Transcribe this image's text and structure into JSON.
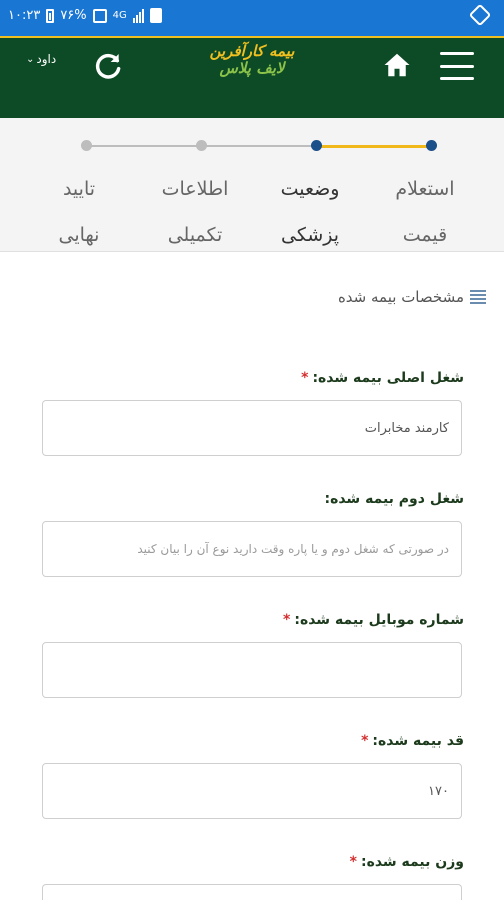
{
  "status_bar": {
    "time": "۱۰:۲۳",
    "battery": "۷۶%",
    "network": "4G"
  },
  "header": {
    "user_name": "داود",
    "logo_line1": "بیمه کارآفرین",
    "logo_line2": "لایف پلاس"
  },
  "stepper": {
    "steps": [
      {
        "line1": "استعلام",
        "line2": "قیمت"
      },
      {
        "line1": "وضعیت",
        "line2": "پزشکی"
      },
      {
        "line1": "اطلاعات",
        "line2": "تکمیلی"
      },
      {
        "line1": "تایید",
        "line2": "نهایی"
      }
    ]
  },
  "form": {
    "section_title": "مشخصات بیمه شده",
    "required_marker": "*",
    "fields": [
      {
        "label": "شغل اصلی بیمه شده:",
        "required": true,
        "value": "کارمند مخابرات",
        "placeholder": ""
      },
      {
        "label": "شغل دوم بیمه شده:",
        "required": false,
        "value": "",
        "placeholder": "در صورتی که شغل دوم و یا پاره وقت دارید نوع آن را بیان کنید"
      },
      {
        "label": "شماره موبایل بیمه شده:",
        "required": true,
        "value": "",
        "placeholder": ""
      },
      {
        "label": "قد بیمه شده:",
        "required": true,
        "value": "۱۷۰",
        "placeholder": ""
      },
      {
        "label": "وزن بیمه شده:",
        "required": true,
        "value": "",
        "placeholder": ""
      }
    ]
  },
  "colors": {
    "status_bar": "#1976d2",
    "header": "#0d4a26",
    "accent": "#f0b818",
    "active_step": "#1b4f8a",
    "required": "#d32f2f"
  }
}
